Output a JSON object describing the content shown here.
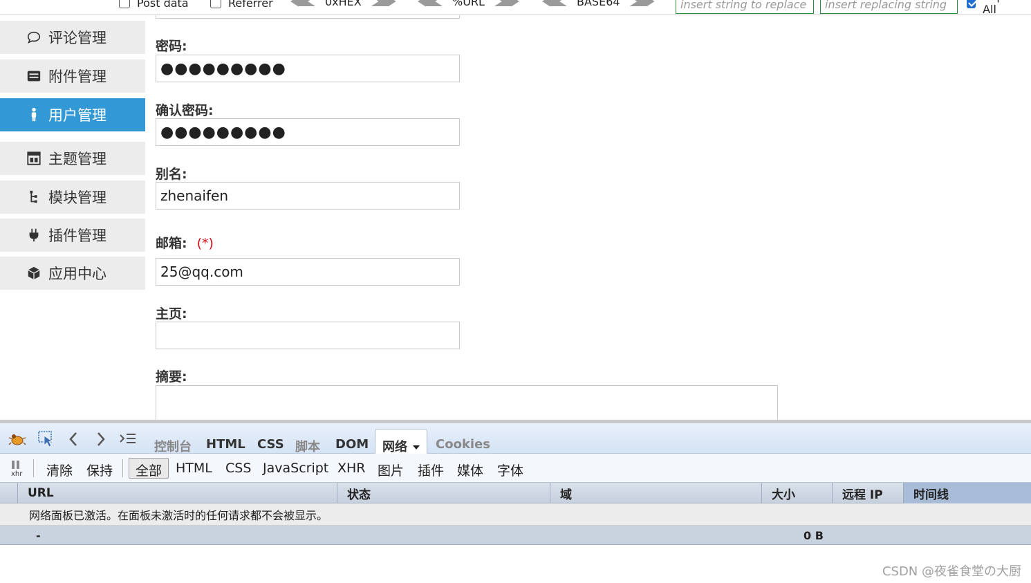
{
  "topbar": {
    "post_data": "Post data",
    "referrer": "Referrer",
    "hex": "0xHEX",
    "url": "%URL",
    "base64": "BASE64",
    "replace_placeholder": "insert string to replace",
    "replacing_placeholder": "insert replacing string",
    "replace_all": "Replace All"
  },
  "sidebar": {
    "items": [
      {
        "label": "评论管理",
        "icon": "comment-icon"
      },
      {
        "label": "附件管理",
        "icon": "inbox-icon"
      },
      {
        "label": "用户管理",
        "icon": "user-icon",
        "active": true
      },
      {
        "label": "主题管理",
        "icon": "layout-icon"
      },
      {
        "label": "模块管理",
        "icon": "sitemap-icon"
      },
      {
        "label": "插件管理",
        "icon": "plug-icon"
      },
      {
        "label": "应用中心",
        "icon": "cube-icon"
      }
    ]
  },
  "form": {
    "password_label": "密码:",
    "password_value": "●●●●●●●●●",
    "confirm_label": "确认密码:",
    "confirm_value": "●●●●●●●●●",
    "alias_label": "别名:",
    "alias_value": "zhenaifen",
    "email_label": "邮箱:",
    "email_required": "(*)",
    "email_value": "25@qq.com",
    "homepage_label": "主页:",
    "homepage_value": "",
    "summary_label": "摘要:"
  },
  "firebug": {
    "tabs": [
      "控制台",
      "HTML",
      "CSS",
      "脚本",
      "DOM",
      "网络",
      "Cookies"
    ],
    "active_tab": "网络",
    "subtabs": {
      "xhr": "xhr",
      "clear": "清除",
      "persist": "保持",
      "all": "全部",
      "html": "HTML",
      "css": "CSS",
      "js": "JavaScript",
      "xhr2": "XHR",
      "images": "图片",
      "plugins": "插件",
      "media": "媒体",
      "fonts": "字体"
    },
    "columns": {
      "url": "URL",
      "status": "状态",
      "domain": "域",
      "size": "大小",
      "remote_ip": "远程 IP",
      "timeline": "时间线"
    },
    "message": "网络面板已激活。在面板未激活时的任何请求都不会被显示。",
    "summary_dash": "-",
    "summary_size": "0 B"
  },
  "watermark": "CSDN @夜雀食堂の大厨"
}
